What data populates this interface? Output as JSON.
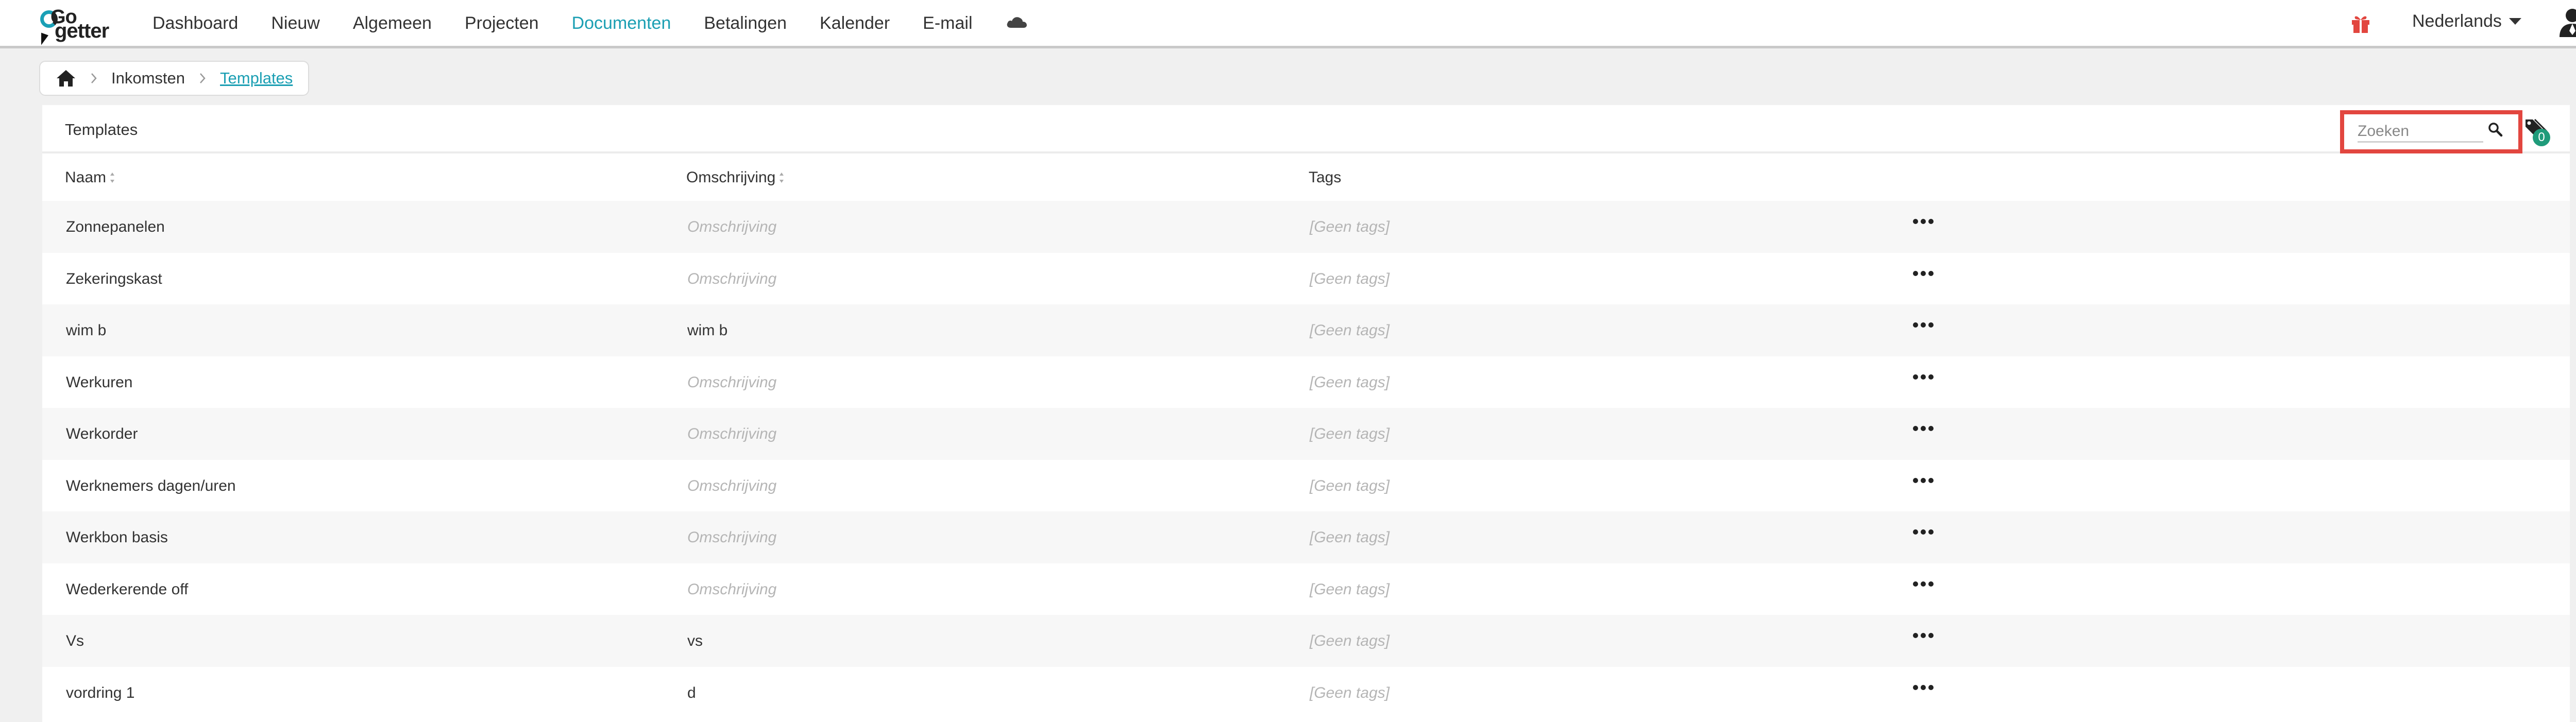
{
  "nav": {
    "logo_top": "Go",
    "logo_bottom": "getter",
    "items": [
      {
        "label": "Dashboard",
        "active": false
      },
      {
        "label": "Nieuw",
        "active": false
      },
      {
        "label": "Algemeen",
        "active": false
      },
      {
        "label": "Projecten",
        "active": false
      },
      {
        "label": "Documenten",
        "active": true
      },
      {
        "label": "Betalingen",
        "active": false
      },
      {
        "label": "Kalender",
        "active": false
      },
      {
        "label": "E-mail",
        "active": false
      }
    ],
    "cloud_icon": "cloud-icon",
    "gift_icon": "gift-icon",
    "language": "Nederlands",
    "user_icon": "user-icon"
  },
  "breadcrumb": {
    "home_icon": "home-icon",
    "items": [
      "Inkomsten",
      "Templates"
    ]
  },
  "panel": {
    "title": "Templates",
    "search": {
      "placeholder": "Zoeken",
      "value": ""
    },
    "tag_filter_count": "0"
  },
  "table": {
    "columns": [
      "Naam",
      "Omschrijving",
      "Tags"
    ],
    "rows": [
      {
        "name": "Zonnepanelen",
        "description": "Omschrijving",
        "description_placeholder": true,
        "tags": "[Geen tags]"
      },
      {
        "name": "Zekeringskast",
        "description": "Omschrijving",
        "description_placeholder": true,
        "tags": "[Geen tags]"
      },
      {
        "name": "wim b",
        "description": "wim b",
        "description_placeholder": false,
        "tags": "[Geen tags]"
      },
      {
        "name": "Werkuren",
        "description": "Omschrijving",
        "description_placeholder": true,
        "tags": "[Geen tags]"
      },
      {
        "name": "Werkorder",
        "description": "Omschrijving",
        "description_placeholder": true,
        "tags": "[Geen tags]"
      },
      {
        "name": "Werknemers dagen/uren",
        "description": "Omschrijving",
        "description_placeholder": true,
        "tags": "[Geen tags]"
      },
      {
        "name": "Werkbon basis",
        "description": "Omschrijving",
        "description_placeholder": true,
        "tags": "[Geen tags]"
      },
      {
        "name": "Wederkerende off",
        "description": "Omschrijving",
        "description_placeholder": true,
        "tags": "[Geen tags]"
      },
      {
        "name": "Vs",
        "description": "vs",
        "description_placeholder": false,
        "tags": "[Geen tags]"
      },
      {
        "name": "vordring 1",
        "description": "d",
        "description_placeholder": false,
        "tags": "[Geen tags]"
      }
    ]
  },
  "colors": {
    "accent": "#1b9fb3",
    "highlight": "#e2463f",
    "badge": "#1f9b7a"
  }
}
